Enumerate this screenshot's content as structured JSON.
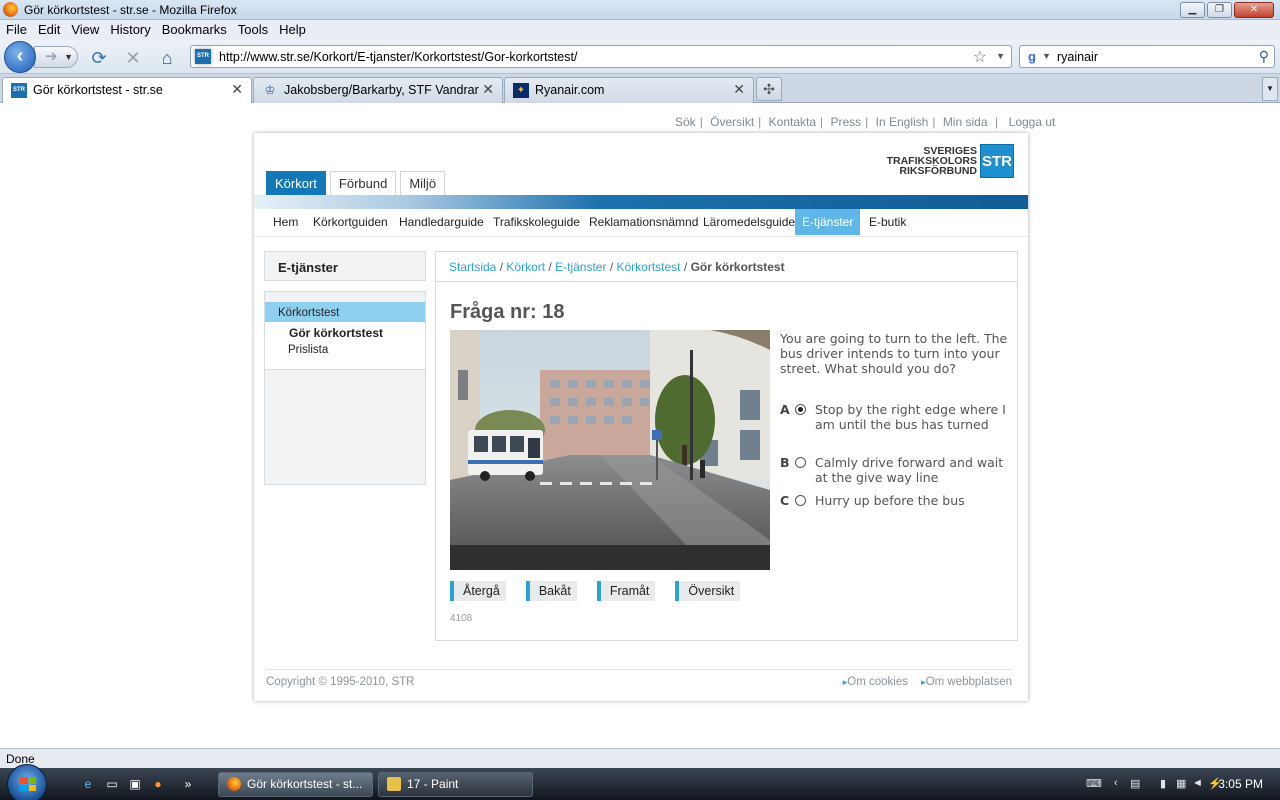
{
  "window": {
    "title": "Gör körkortstest - str.se - Mozilla Firefox"
  },
  "menu": [
    "File",
    "Edit",
    "View",
    "History",
    "Bookmarks",
    "Tools",
    "Help"
  ],
  "navbar": {
    "url": "http://www.str.se/Korkort/E-tjanster/Korkortstest/Gor-korkortstest/",
    "search_value": "ryainair"
  },
  "tabs": [
    {
      "label": "Gör körkortstest - str.se",
      "active": true
    },
    {
      "label": "Jakobsberg/Barkarby, STF Vandrarh...",
      "active": false
    },
    {
      "label": "Ryanair.com",
      "active": false
    }
  ],
  "utility_links": [
    "Sök",
    "Översikt",
    "Kontakta",
    "Press",
    "In English",
    "Min sida",
    "Logga ut"
  ],
  "logo": {
    "line1": "SVERIGES",
    "line2": "TRAFIKSKOLORS",
    "line3": "RIKSFÖRBUND",
    "mark": "STR"
  },
  "top_tabs": [
    "Körkort",
    "Förbund",
    "Miljö"
  ],
  "subnav": [
    "Hem",
    "Körkortguiden",
    "Handledarguide",
    "Trafikskoleguide",
    "Reklamationsnämnd",
    "Läromedelsguide",
    "E-tjänster",
    "E-butik"
  ],
  "sidebar": {
    "heading": "E-tjänster",
    "section": "Körkortstest",
    "items": [
      "Gör körkortstest",
      "Prislista"
    ]
  },
  "breadcrumb": [
    "Startsida",
    "Körkort",
    "E-tjänster",
    "Körkortstest",
    "Gör körkortstest"
  ],
  "question": {
    "title": "Fråga nr: 18",
    "text": "You are going to turn to the left. The bus driver intends to turn into your street. What should you do?",
    "options": [
      {
        "letter": "A",
        "text": "Stop by the right edge where I am until the bus has turned",
        "selected": true
      },
      {
        "letter": "B",
        "text": "Calmly drive forward and wait at the give way line",
        "selected": false
      },
      {
        "letter": "C",
        "text": "Hurry up before the bus",
        "selected": false
      }
    ],
    "id": "4108"
  },
  "actions": [
    "Återgå",
    "Bakåt",
    "Framåt",
    "Översikt"
  ],
  "footer": {
    "copyright": "Copyright © 1995-2010, STR",
    "links": [
      "Om cookies",
      "Om webbplatsen"
    ]
  },
  "status": "Done",
  "taskbar": {
    "tasks": [
      "Gör körkortstest - st...",
      "17 - Paint"
    ],
    "clock": "3:05 PM"
  }
}
